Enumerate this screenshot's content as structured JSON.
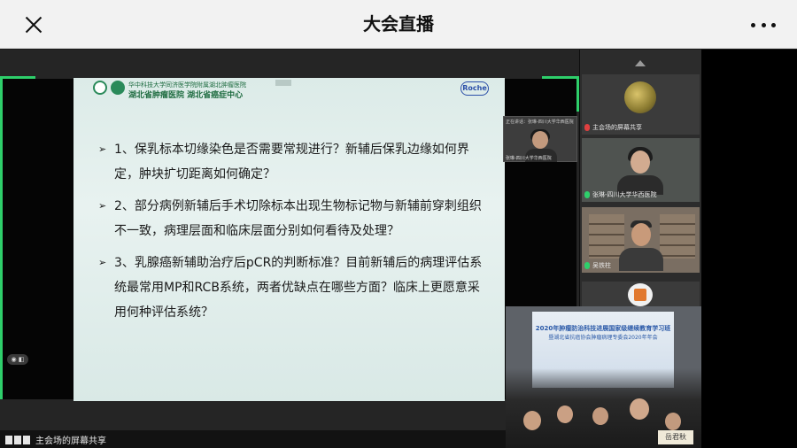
{
  "header": {
    "title": "大会直播"
  },
  "slide": {
    "hospital_line1": "华中科技大学同济医学院附属湖北肿瘤医院",
    "hospital_line2": "湖北省肿瘤医院  湖北省癌症中心",
    "brand": "Roche",
    "bullets": [
      {
        "marker": "➢",
        "text": "1、保乳标本切缘染色是否需要常规进行？新辅后保乳边缘如何界定，肿块扩切距离如何确定？"
      },
      {
        "marker": "➢",
        "text": "2、部分病例新辅后手术切除标本出现生物标记物与新辅前穿刺组织不一致，病理层面和临床层面分别如何看待及处理？"
      },
      {
        "marker": "➢",
        "text": "3、乳腺癌新辅助治疗后pCR的判断标准？目前新辅后的病理评估系统最常用MP和RCB系统，两者优缺点在哪些方面？临床上更愿意采用何种评估系统？"
      }
    ]
  },
  "pip": {
    "caption": "正在讲话：张琳-四川大学华西医院",
    "name": "张琳-四川大学华西医院"
  },
  "participants": [
    {
      "label": "主会场的屏幕共享"
    },
    {
      "label": "张琳-四川大学华西医院"
    },
    {
      "label": "吴铁柱"
    }
  ],
  "venue": {
    "banner_title": "2020年肿瘤防治科技进展国家级继续教育学习班",
    "banner_sub": "暨湖北省抗癌协会肿瘤病理专委会2020年年会",
    "name_card": "岳君秋"
  },
  "footer": {
    "share_label": "主会场的屏幕共享"
  },
  "screen_badge": "◉ ◧"
}
